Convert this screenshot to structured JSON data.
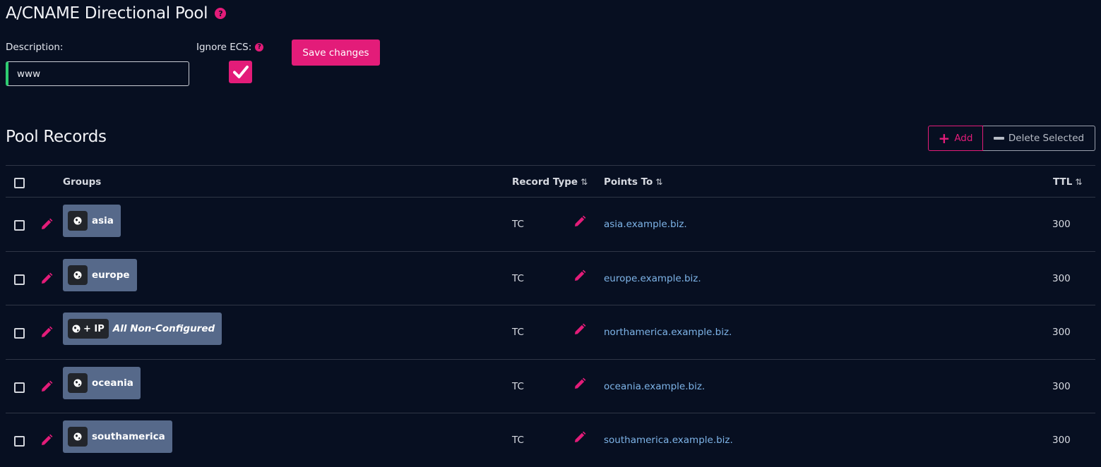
{
  "header": {
    "title": "A/CNAME Directional Pool",
    "help_glyph": "?"
  },
  "form": {
    "description_label": "Description:",
    "description_value": "www",
    "ignore_ecs_label": "Ignore ECS:",
    "ignore_ecs_checked": true,
    "save_label": "Save changes"
  },
  "records": {
    "title": "Pool Records",
    "add_label": "Add",
    "delete_label": "Delete Selected",
    "columns": {
      "groups": "Groups",
      "record_type": "Record Type",
      "points_to": "Points To",
      "ttl": "TTL"
    },
    "sort_glyph": "⇅",
    "rows": [
      {
        "group_prefix": "",
        "group": "asia",
        "type": "TC",
        "points_to": "asia.example.biz.",
        "ttl": "300"
      },
      {
        "group_prefix": "",
        "group": "europe",
        "type": "TC",
        "points_to": "europe.example.biz.",
        "ttl": "300"
      },
      {
        "group_prefix": "+ IP",
        "group": "All Non-Configured",
        "type": "TC",
        "points_to": "northamerica.example.biz.",
        "ttl": "300"
      },
      {
        "group_prefix": "",
        "group": "oceania",
        "type": "TC",
        "points_to": "oceania.example.biz.",
        "ttl": "300"
      },
      {
        "group_prefix": "",
        "group": "southamerica",
        "type": "TC",
        "points_to": "southamerica.example.biz.",
        "ttl": "300"
      }
    ]
  },
  "icons": {
    "help": "question-circle-icon",
    "edit": "pencil-icon",
    "group": "globe-icon",
    "check": "checkmark-icon",
    "add": "plus-icon",
    "delete": "minus-icon"
  },
  "colors": {
    "background": "#070f21",
    "accent": "#e31c79",
    "link": "#7eb4e8",
    "badge": "#56698a",
    "valid_border": "#2ecc71"
  }
}
